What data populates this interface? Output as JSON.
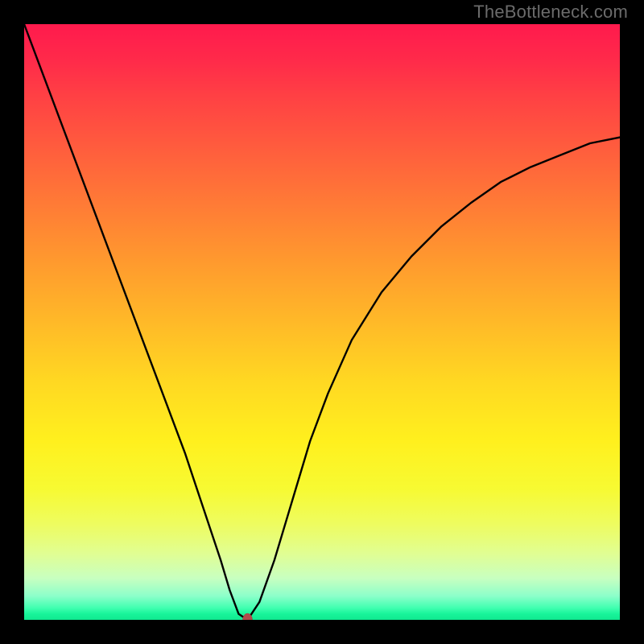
{
  "watermark": "TheBottleneck.com",
  "chart_data": {
    "type": "line",
    "title": "",
    "xlabel": "",
    "ylabel": "",
    "xlim": [
      0,
      100
    ],
    "ylim": [
      0,
      100
    ],
    "grid": false,
    "background": {
      "type": "vertical-gradient",
      "stops": [
        {
          "pos": 0,
          "color": "#ff1a4d"
        },
        {
          "pos": 50,
          "color": "#ffb928"
        },
        {
          "pos": 70,
          "color": "#fff01e"
        },
        {
          "pos": 100,
          "color": "#10e890"
        }
      ]
    },
    "series": [
      {
        "name": "bottleneck-curve",
        "x": [
          0,
          3,
          6,
          9,
          12,
          15,
          18,
          21,
          24,
          27,
          29,
          31,
          33,
          34.5,
          36,
          37.5,
          39.5,
          42,
          45,
          48,
          51,
          55,
          60,
          65,
          70,
          75,
          80,
          85,
          90,
          95,
          100
        ],
        "y": [
          100,
          92,
          84,
          76,
          68,
          60,
          52,
          44,
          36,
          28,
          22,
          16,
          10,
          5,
          1,
          0,
          3,
          10,
          20,
          30,
          38,
          47,
          55,
          61,
          66,
          70,
          73.5,
          76,
          78,
          80,
          81
        ],
        "color": "#000000"
      }
    ],
    "marker": {
      "x": 37.5,
      "y": 0,
      "color": "#b04a4a",
      "shape": "ellipse"
    }
  }
}
